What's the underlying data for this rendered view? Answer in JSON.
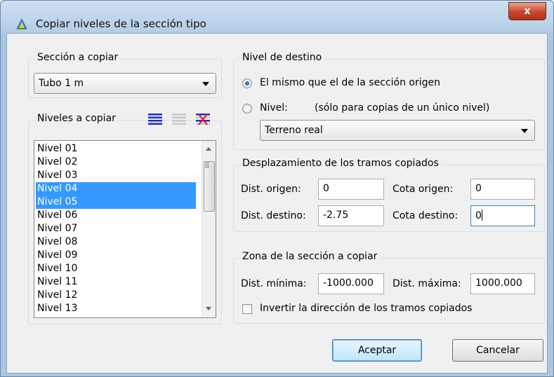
{
  "window": {
    "title": "Copiar niveles de la sección tipo",
    "close_glyph": "x"
  },
  "seccion": {
    "legend": "Sección a copiar",
    "selected": "Tubo 1 m"
  },
  "niveles": {
    "legend": "Niveles a copiar",
    "icons": [
      "select-all-icon",
      "select-none-icon",
      "invert-selection-icon"
    ],
    "items": [
      {
        "label": "Nivel 01",
        "selected": false
      },
      {
        "label": "Nivel 02",
        "selected": false
      },
      {
        "label": "Nivel 03",
        "selected": false
      },
      {
        "label": "Nivel 04",
        "selected": true
      },
      {
        "label": "Nivel 05",
        "selected": true
      },
      {
        "label": "Nivel 06",
        "selected": false
      },
      {
        "label": "Nivel 07",
        "selected": false
      },
      {
        "label": "Nivel 08",
        "selected": false
      },
      {
        "label": "Nivel 09",
        "selected": false
      },
      {
        "label": "Nivel 10",
        "selected": false
      },
      {
        "label": "Nivel 11",
        "selected": false
      },
      {
        "label": "Nivel 12",
        "selected": false
      },
      {
        "label": "Nivel 13",
        "selected": false
      }
    ]
  },
  "destino": {
    "legend": "Nivel de destino",
    "radio_same": "El mismo que el de la sección origen",
    "radio_nivel": "Nivel:",
    "radio_nivel_note": "(sólo para copias de un único nivel)",
    "nivel_selected": "Terreno real"
  },
  "desplazamiento": {
    "legend": "Desplazamiento de los tramos copiados",
    "dist_origen_label": "Dist. origen:",
    "dist_origen_value": "0",
    "cota_origen_label": "Cota origen:",
    "cota_origen_value": "0",
    "dist_destino_label": "Dist. destino:",
    "dist_destino_value": "-2.75",
    "cota_destino_label": "Cota destino:",
    "cota_destino_value": "0"
  },
  "zona": {
    "legend": "Zona de la sección a copiar",
    "dist_minima_label": "Dist. mínima:",
    "dist_minima_value": "-1000.000",
    "dist_maxima_label": "Dist. máxima:",
    "dist_maxima_value": "1000.000",
    "invertir_label": "Invertir la dirección de los tramos copiados"
  },
  "buttons": {
    "accept": "Aceptar",
    "cancel": "Cancelar"
  },
  "colors": {
    "selection": "#3399ff",
    "title_bar": "#b3cde6",
    "close_button": "#c6472e",
    "dialog_bg": "#f0f0f0",
    "icon_blue": "#1a2bd6",
    "icon_red": "#e0202a"
  }
}
